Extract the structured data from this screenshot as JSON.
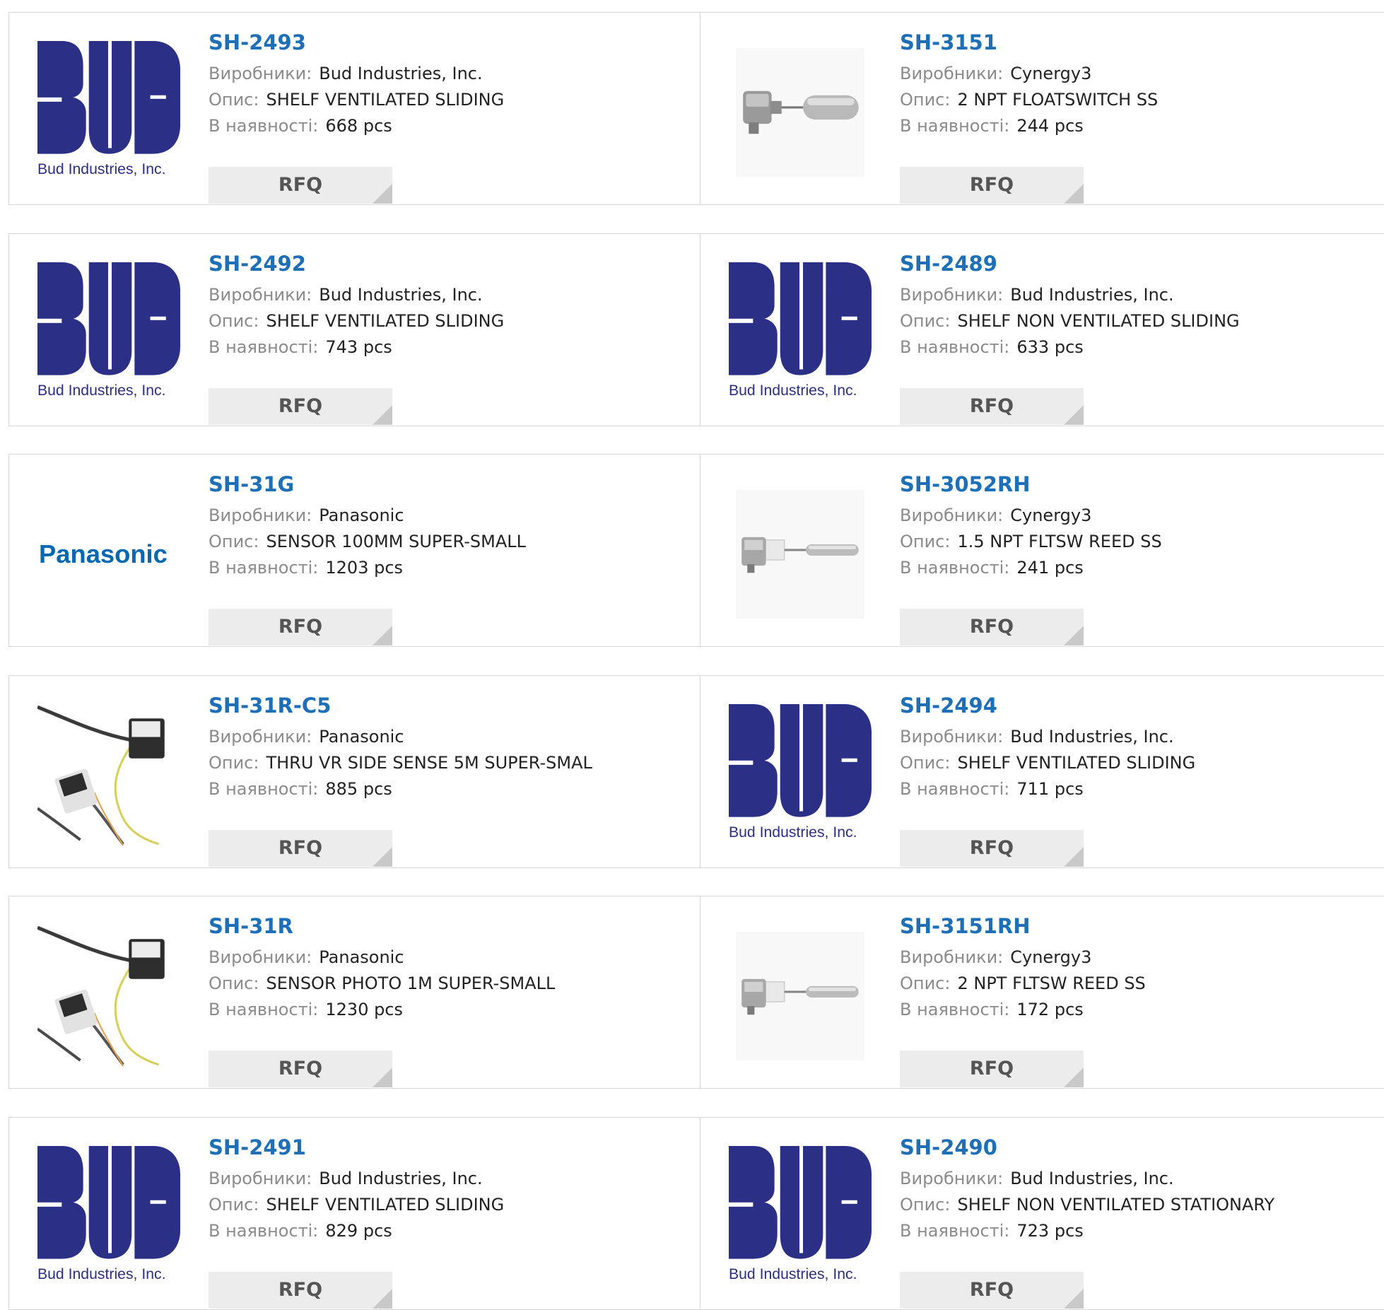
{
  "labels": {
    "manufacturer": "Виробники:",
    "description": "Опис:",
    "stock": "В наявності:",
    "rfq": "RFQ"
  },
  "colors": {
    "part_link": "#1d6fb8",
    "bud_logo": "#2b2f86",
    "panasonic_logo": "#0067b1"
  },
  "products": [
    {
      "part": "SH-2493",
      "manufacturer": "Bud Industries, Inc.",
      "description": "SHELF VENTILATED SLIDING",
      "stock": "668 pcs",
      "image": "bud",
      "logo_text": "Bud Industries, Inc."
    },
    {
      "part": "SH-3151",
      "manufacturer": "Cynergy3",
      "description": "2 NPT FLOATSWITCH SS",
      "stock": "244 pcs",
      "image": "floatswitch-photo"
    },
    {
      "part": "SH-2492",
      "manufacturer": "Bud Industries, Inc.",
      "description": "SHELF VENTILATED SLIDING",
      "stock": "743 pcs",
      "image": "bud",
      "logo_text": "Bud Industries, Inc."
    },
    {
      "part": "SH-2489",
      "manufacturer": "Bud Industries, Inc.",
      "description": "SHELF NON VENTILATED SLIDING",
      "stock": "633 pcs",
      "image": "bud",
      "logo_text": "Bud Industries, Inc."
    },
    {
      "part": "SH-31G",
      "manufacturer": "Panasonic",
      "description": "SENSOR 100MM SUPER-SMALL",
      "stock": "1203 pcs",
      "image": "panasonic",
      "logo_text": "Panasonic"
    },
    {
      "part": "SH-3052RH",
      "manufacturer": "Cynergy3",
      "description": "1.5 NPT FLTSW REED SS",
      "stock": "241 pcs",
      "image": "reed-switch-photo"
    },
    {
      "part": "SH-31R-C5",
      "manufacturer": "Panasonic",
      "description": "THRU VR SIDE SENSE 5M SUPER-SMAL",
      "stock": "885 pcs",
      "image": "sensor-photo"
    },
    {
      "part": "SH-2494",
      "manufacturer": "Bud Industries, Inc.",
      "description": "SHELF VENTILATED SLIDING",
      "stock": "711 pcs",
      "image": "bud",
      "logo_text": "Bud Industries, Inc."
    },
    {
      "part": "SH-31R",
      "manufacturer": "Panasonic",
      "description": "SENSOR PHOTO 1M SUPER-SMALL",
      "stock": "1230 pcs",
      "image": "sensor-photo"
    },
    {
      "part": "SH-3151RH",
      "manufacturer": "Cynergy3",
      "description": "2 NPT FLTSW REED SS",
      "stock": "172 pcs",
      "image": "reed-switch-photo"
    },
    {
      "part": "SH-2491",
      "manufacturer": "Bud Industries, Inc.",
      "description": "SHELF VENTILATED SLIDING",
      "stock": "829 pcs",
      "image": "bud",
      "logo_text": "Bud Industries, Inc."
    },
    {
      "part": "SH-2490",
      "manufacturer": "Bud Industries, Inc.",
      "description": "SHELF NON VENTILATED STATIONARY",
      "stock": "723 pcs",
      "image": "bud",
      "logo_text": "Bud Industries, Inc."
    }
  ]
}
